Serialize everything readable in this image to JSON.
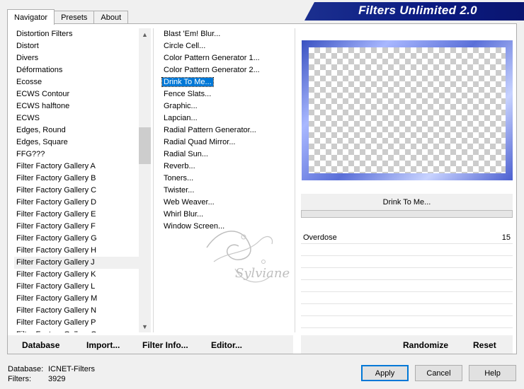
{
  "tabs": [
    {
      "label": "Navigator",
      "active": true
    },
    {
      "label": "Presets",
      "active": false
    },
    {
      "label": "About",
      "active": false
    }
  ],
  "banner": {
    "title": "Filters Unlimited 2.0"
  },
  "categories": {
    "items": [
      "Distortion Filters",
      "Distort",
      "Divers",
      "Déformations",
      "Ecosse",
      "ECWS Contour",
      "ECWS halftone",
      "ECWS",
      "Edges, Round",
      "Edges, Square",
      "FFG???",
      "Filter Factory Gallery A",
      "Filter Factory Gallery B",
      "Filter Factory Gallery C",
      "Filter Factory Gallery D",
      "Filter Factory Gallery E",
      "Filter Factory Gallery F",
      "Filter Factory Gallery G",
      "Filter Factory Gallery H",
      "Filter Factory Gallery J",
      "Filter Factory Gallery K",
      "Filter Factory Gallery L",
      "Filter Factory Gallery M",
      "Filter Factory Gallery N",
      "Filter Factory Gallery P",
      "Filter Factory Gallery Q"
    ],
    "selected": "Filter Factory Gallery J"
  },
  "filters": {
    "items": [
      "Blast 'Em! Blur...",
      "Circle Cell...",
      "Color Pattern Generator 1...",
      "Color Pattern Generator 2...",
      "Drink To Me...",
      "Fence Slats...",
      "Graphic...",
      "Lapcian...",
      "Radial Pattern Generator...",
      "Radial Quad Mirror...",
      "Radial Sun...",
      "Reverb...",
      "Toners...",
      "Twister...",
      "Web Weaver...",
      "Whirl Blur...",
      "Window Screen..."
    ],
    "selected": "Drink To Me..."
  },
  "preview": {
    "filter_name": "Drink To Me..."
  },
  "params": [
    {
      "name": "Overdose",
      "value": "15"
    }
  ],
  "bottom_buttons": {
    "database": "Database",
    "import": "Import...",
    "filter_info": "Filter Info...",
    "editor": "Editor...",
    "randomize": "Randomize",
    "reset": "Reset"
  },
  "footer": {
    "database_label": "Database:",
    "database_value": "ICNET-Filters",
    "filters_label": "Filters:",
    "filters_value": "3929"
  },
  "dialog_buttons": {
    "apply": "Apply",
    "cancel": "Cancel",
    "help": "Help"
  },
  "watermark": {
    "text": "Sylviane"
  }
}
